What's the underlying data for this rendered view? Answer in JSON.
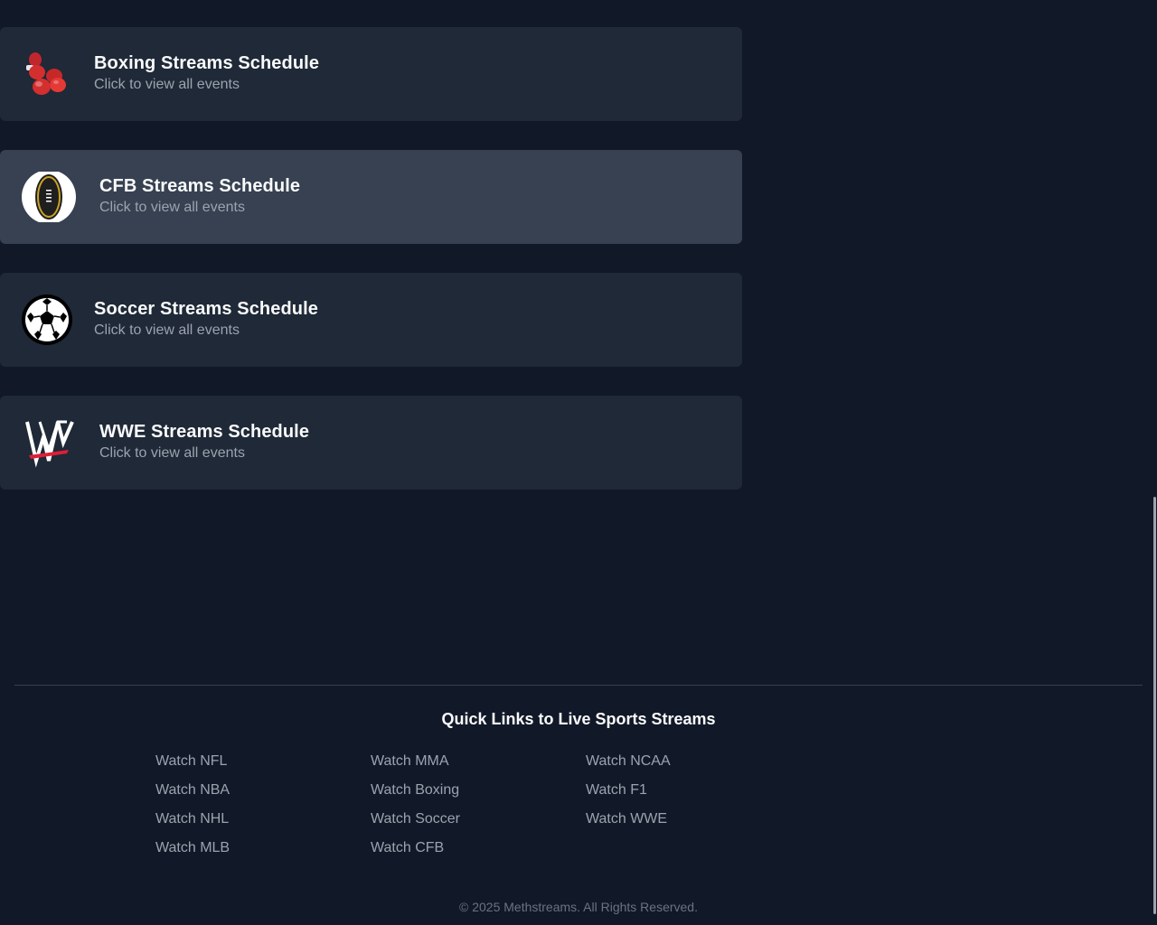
{
  "top_partial_text": "",
  "cards": [
    {
      "title": "Boxing Streams Schedule",
      "subtitle": "Click to view all events",
      "icon": "boxing-gloves-icon"
    },
    {
      "title": "CFB Streams Schedule",
      "subtitle": "Click to view all events",
      "icon": "cfb-football-icon"
    },
    {
      "title": "Soccer Streams Schedule",
      "subtitle": "Click to view all events",
      "icon": "soccer-ball-icon"
    },
    {
      "title": "WWE Streams Schedule",
      "subtitle": "Click to view all events",
      "icon": "wwe-logo-icon"
    }
  ],
  "footer": {
    "quick_links_title": "Quick Links to Live Sports Streams",
    "col1": [
      "Watch NFL",
      "Watch NBA",
      "Watch NHL",
      "Watch MLB"
    ],
    "col2": [
      "Watch MMA",
      "Watch Boxing",
      "Watch Soccer",
      "Watch CFB"
    ],
    "col3": [
      "Watch NCAA",
      "Watch F1",
      "Watch WWE"
    ],
    "copyright": "© 2025 Methstreams. All Rights Reserved."
  },
  "colors": {
    "background": "#111827",
    "card": "#1f2937",
    "card_hover": "#374151",
    "link": "#9ca3af"
  }
}
